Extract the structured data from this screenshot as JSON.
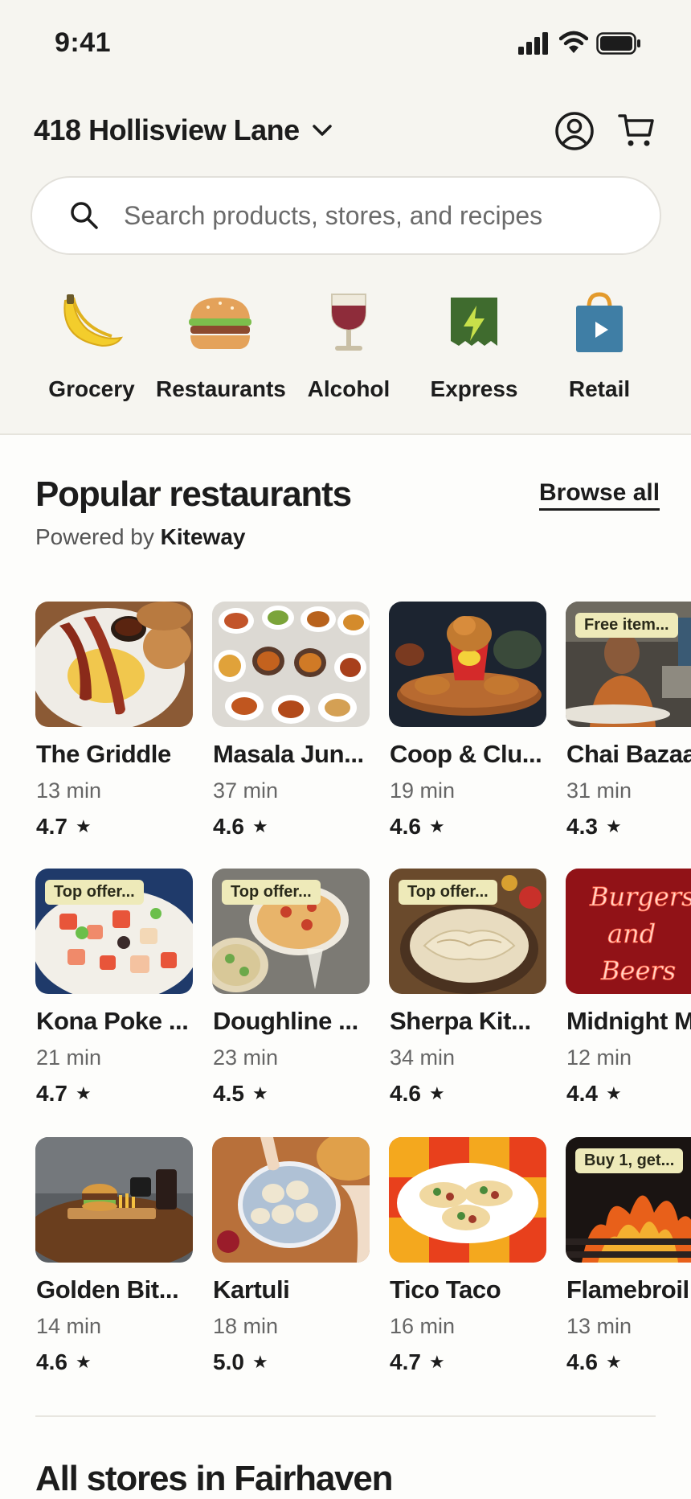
{
  "status_bar": {
    "time": "9:41"
  },
  "header": {
    "address": "418 Hollisview Lane"
  },
  "search": {
    "placeholder": "Search products, stores, and recipes"
  },
  "categories": [
    {
      "label": "Grocery",
      "icon": "banana-icon"
    },
    {
      "label": "Restaurants",
      "icon": "burger-icon"
    },
    {
      "label": "Alcohol",
      "icon": "wine-glass-icon"
    },
    {
      "label": "Express",
      "icon": "express-bolt-icon"
    },
    {
      "label": "Retail",
      "icon": "shopping-bag-icon"
    }
  ],
  "popular": {
    "title": "Popular restaurants",
    "browse_label": "Browse all",
    "powered_prefix": "Powered by",
    "powered_brand": "Kiteway",
    "restaurants": [
      {
        "name": "The Griddle",
        "time": "13 min",
        "rating": "4.7",
        "badge": ""
      },
      {
        "name": "Masala Jun...",
        "time": "37 min",
        "rating": "4.6",
        "badge": ""
      },
      {
        "name": "Coop & Clu...",
        "time": "19 min",
        "rating": "4.6",
        "badge": ""
      },
      {
        "name": "Chai Bazaa",
        "time": "31 min",
        "rating": "4.3",
        "badge": "Free item..."
      },
      {
        "name": "Kona Poke ...",
        "time": "21 min",
        "rating": "4.7",
        "badge": "Top offer..."
      },
      {
        "name": "Doughline ...",
        "time": "23 min",
        "rating": "4.5",
        "badge": "Top offer..."
      },
      {
        "name": "Sherpa Kit...",
        "time": "34 min",
        "rating": "4.6",
        "badge": "Top offer..."
      },
      {
        "name": "Midnight M",
        "time": "12 min",
        "rating": "4.4",
        "badge": ""
      },
      {
        "name": "Golden Bit...",
        "time": "14 min",
        "rating": "4.6",
        "badge": ""
      },
      {
        "name": "Kartuli",
        "time": "18 min",
        "rating": "5.0",
        "badge": ""
      },
      {
        "name": "Tico Taco",
        "time": "16 min",
        "rating": "4.7",
        "badge": ""
      },
      {
        "name": "Flamebroil",
        "time": "13 min",
        "rating": "4.6",
        "badge": "Buy 1, get..."
      }
    ],
    "neon_sign": [
      "Burgers",
      "and",
      "Beers"
    ]
  },
  "stores_section": {
    "title": "All stores in Fairhaven"
  },
  "colors": {
    "header_bg": "#f6f5f0",
    "badge_bg": "#eeeab9",
    "text": "#1c1c1c"
  }
}
